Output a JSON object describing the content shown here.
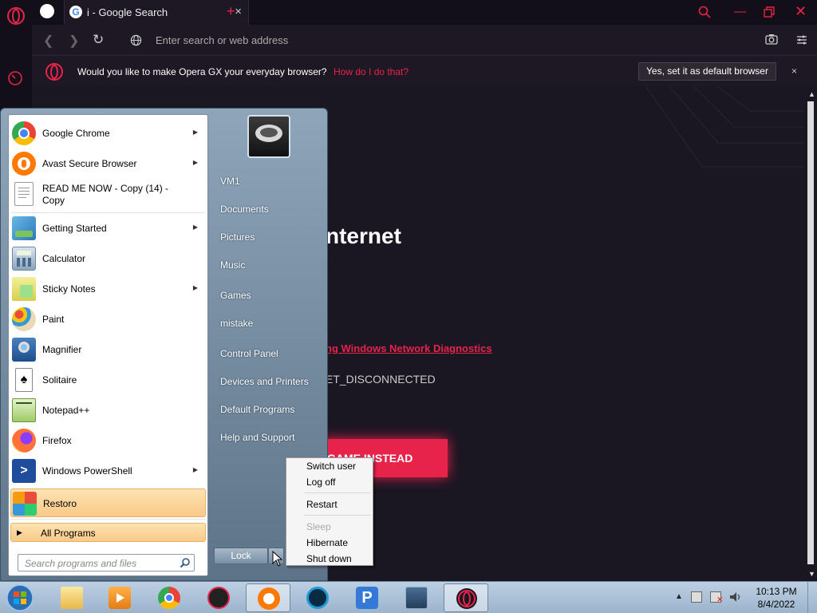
{
  "browser": {
    "tab": {
      "title": "i - Google Search",
      "favicon": "G"
    },
    "address_placeholder": "Enter search or web address",
    "infobar": {
      "message": "Would you like to make Opera GX your everyday browser?",
      "link": "How do I do that?",
      "button": "Yes, set it as default browser",
      "close": "×"
    },
    "content": {
      "heading": "nternet",
      "diagnostics_link": "ng Windows Network Diagnostics",
      "error_code": "ET_DISCONNECTED",
      "game_button": "GAME INSTEAD"
    }
  },
  "start_menu": {
    "programs": [
      {
        "label": "Google Chrome",
        "icon": "chrome-icon",
        "submenu": true
      },
      {
        "label": "Avast Secure Browser",
        "icon": "avast-browser-icon",
        "submenu": true
      },
      {
        "label": "READ ME NOW - Copy (14) - Copy",
        "icon": "text-file-icon",
        "submenu": false
      },
      {
        "label": "Getting Started",
        "icon": "getting-started-icon",
        "submenu": true
      },
      {
        "label": "Calculator",
        "icon": "calculator-icon",
        "submenu": false
      },
      {
        "label": "Sticky Notes",
        "icon": "sticky-notes-icon",
        "submenu": true
      },
      {
        "label": "Paint",
        "icon": "paint-icon",
        "submenu": false
      },
      {
        "label": "Magnifier",
        "icon": "magnifier-icon",
        "submenu": false
      },
      {
        "label": "Solitaire",
        "icon": "solitaire-icon",
        "submenu": false
      },
      {
        "label": "Notepad++",
        "icon": "notepadpp-icon",
        "submenu": false
      },
      {
        "label": "Firefox",
        "icon": "firefox-icon",
        "submenu": false
      },
      {
        "label": "Windows PowerShell",
        "icon": "powershell-icon",
        "submenu": true
      },
      {
        "label": "Restoro",
        "icon": "restoro-icon",
        "submenu": false
      }
    ],
    "all_programs": "All Programs",
    "search_placeholder": "Search programs and files",
    "right_links": [
      "VM1",
      "Documents",
      "Pictures",
      "Music",
      "Games",
      "mistake",
      "Control Panel",
      "Devices and Printers",
      "Default Programs",
      "Help and Support"
    ],
    "lock_button": "Lock"
  },
  "power_menu": {
    "switch_user": "Switch user",
    "log_off": "Log off",
    "restart": "Restart",
    "sleep": "Sleep",
    "hibernate": "Hibernate",
    "shut_down": "Shut down"
  },
  "taskbar": {
    "apps": [
      "explorer",
      "media-player",
      "chrome",
      "game-launcher",
      "avast-secure-browser",
      "ccleaner",
      "pdf-app",
      "image-viewer",
      "opera-gx"
    ],
    "time": "10:13 PM",
    "date": "8/4/2022"
  },
  "colors": {
    "accent": "#e8234a",
    "browser_bg": "#1a1622",
    "start_menu_hover": "#fac987"
  }
}
